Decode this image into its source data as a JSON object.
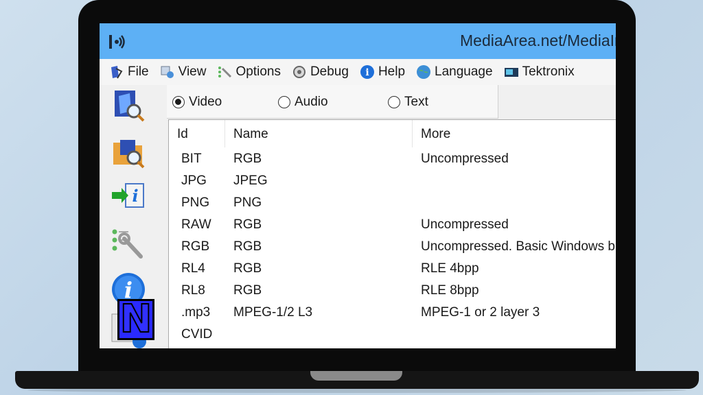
{
  "window": {
    "title": "MediaArea.net/MediaInfo"
  },
  "menu": [
    {
      "label": "File",
      "icon": "file-icon"
    },
    {
      "label": "View",
      "icon": "view-icon"
    },
    {
      "label": "Options",
      "icon": "options-icon"
    },
    {
      "label": "Debug",
      "icon": "debug-icon"
    },
    {
      "label": "Help",
      "icon": "help-icon"
    },
    {
      "label": "Language",
      "icon": "language-icon"
    },
    {
      "label": "Tektronix",
      "icon": "tektronix-icon"
    }
  ],
  "sidebar": [
    {
      "icon": "open-file-icon"
    },
    {
      "icon": "open-folder-icon"
    },
    {
      "icon": "export-icon"
    },
    {
      "icon": "preferences-icon"
    },
    {
      "icon": "about-icon"
    },
    {
      "icon": "knowledge-icon"
    }
  ],
  "radios": {
    "video": {
      "label": "Video",
      "selected": true
    },
    "audio": {
      "label": "Audio",
      "selected": false
    },
    "text": {
      "label": "Text",
      "selected": false
    }
  },
  "table": {
    "columns": [
      "Id",
      "Name",
      "More"
    ],
    "rows": [
      [
        "BIT",
        "RGB",
        "Uncompressed"
      ],
      [
        "JPG",
        "JPEG",
        ""
      ],
      [
        "PNG",
        "PNG",
        ""
      ],
      [
        "RAW",
        "RGB",
        "Uncompressed"
      ],
      [
        "RGB",
        "RGB",
        "Uncompressed. Basic Windows bitmap format"
      ],
      [
        "RL4",
        "RGB",
        "RLE 4bpp"
      ],
      [
        "RL8",
        "RGB",
        "RLE 8bpp"
      ],
      [
        ".mp3",
        "MPEG-1/2 L3",
        "MPEG-1 or 2 layer 3"
      ],
      [
        "CVID",
        "",
        ""
      ]
    ]
  },
  "overlay": {
    "letter": "N"
  },
  "colors": {
    "titlebar": "#5db0f5",
    "accent": "#1e6fd9",
    "logo_blue": "#2a2aff"
  }
}
